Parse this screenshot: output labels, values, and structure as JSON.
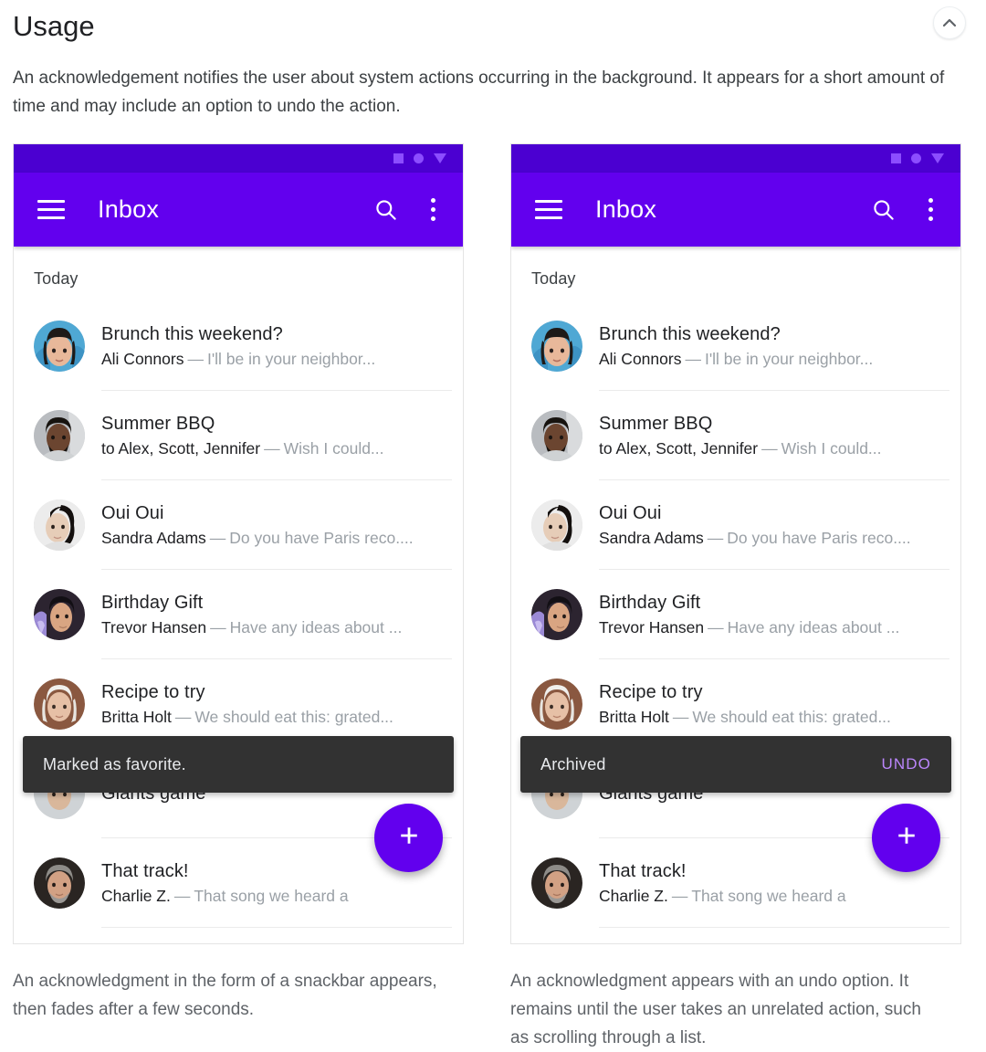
{
  "header": {
    "title": "Usage",
    "collapse_icon": "chevron-up-icon",
    "intro": "An acknowledgement notifies the user about system actions occurring in the background. It appears for a short amount of time and may include an option to undo the action."
  },
  "colors": {
    "appbar_purple": "#6200ee",
    "statusbar_purple": "#4b00d1",
    "statusbar_icon_purple": "#8c4dff",
    "snackbar_dark": "#323232",
    "undo_purple": "#bb86fc",
    "fab_purple": "#6200ee"
  },
  "appbar": {
    "menu_icon": "hamburger-menu-icon",
    "title": "Inbox",
    "search_icon": "search-icon",
    "overflow_icon": "more-vertical-icon"
  },
  "statusbar": {
    "icons": [
      "square-icon",
      "circle-icon",
      "triangle-down-icon"
    ]
  },
  "list": {
    "section_label": "Today",
    "rows": [
      {
        "title": "Brunch this weekend?",
        "sender": "Ali Connors",
        "dash": "—",
        "snippet": "I'll be in your neighbor...",
        "avatar": "avatar-ali-connors"
      },
      {
        "title": "Summer BBQ",
        "sender": "to Alex, Scott, Jennifer",
        "dash": "—",
        "snippet": "Wish I could...",
        "avatar": "avatar-summer-bbq"
      },
      {
        "title": "Oui Oui",
        "sender": "Sandra Adams",
        "dash": "—",
        "snippet": "Do you have Paris reco....",
        "avatar": "avatar-sandra-adams"
      },
      {
        "title": "Birthday Gift",
        "sender": "Trevor Hansen",
        "dash": "—",
        "snippet": "Have any ideas about ...",
        "avatar": "avatar-trevor-hansen"
      },
      {
        "title": "Recipe to try",
        "sender": "Britta Holt",
        "dash": "—",
        "snippet": "We should eat this: grated...",
        "avatar": "avatar-britta-holt"
      },
      {
        "title": "Giants game",
        "sender": "",
        "dash": "",
        "snippet": "",
        "avatar": "avatar-giants-game"
      },
      {
        "title": "That track!",
        "sender": "Charlie Z.",
        "dash": "—",
        "snippet": "That song we heard a",
        "avatar": "avatar-charlie-z"
      }
    ]
  },
  "left_panel": {
    "snackbar": {
      "message": "Marked as favorite.",
      "action": ""
    },
    "fab_icon": "plus-icon",
    "caption": "An acknowledgment in the form of a snackbar appears, then fades after a few seconds."
  },
  "right_panel": {
    "snackbar": {
      "message": "Archived",
      "action": "UNDO"
    },
    "fab_icon": "plus-icon",
    "caption": "An acknowledgment appears with an undo option. It remains until the user takes an unrelated action, such as scrolling through a list."
  }
}
